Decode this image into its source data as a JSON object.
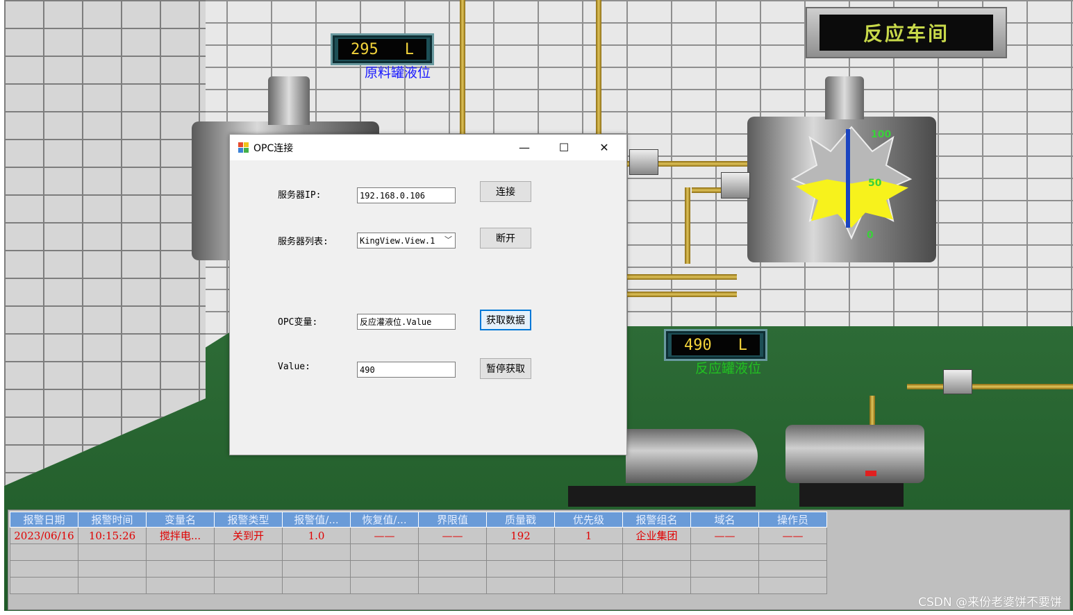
{
  "scene": {
    "raw_tank": {
      "value": "295",
      "unit": "L",
      "label": "原料罐液位"
    },
    "reactor_tank": {
      "value": "490",
      "unit": "L",
      "label": "反应罐液位",
      "scale": [
        "100",
        "50",
        "0"
      ],
      "level_fraction": 0.49
    },
    "workshop_title": "反应车间",
    "colors": {
      "display_text": "#f2d33b",
      "raw_label": "#1a1aff",
      "reactor_label": "#22c022",
      "alarm_text": "#e00000"
    }
  },
  "dialog": {
    "title": "OPC连接",
    "server_ip_label": "服务器IP:",
    "server_ip_value": "192.168.0.106",
    "server_list_label": "服务器列表:",
    "server_list_selected": "KingView.View.1",
    "opc_var_label": "OPC变量:",
    "opc_var_value": "反应灌液位.Value",
    "value_label": "Value:",
    "value_value": "490",
    "connect_btn": "连接",
    "disconnect_btn": "断开",
    "fetch_btn": "获取数据",
    "pause_btn": "暂停获取",
    "minimize_glyph": "—",
    "maximize_glyph": "☐",
    "close_glyph": "✕"
  },
  "alarm_table": {
    "headers": [
      "报警日期",
      "报警时间",
      "变量名",
      "报警类型",
      "报警值/...",
      "恢复值/...",
      "界限值",
      "质量戳",
      "优先级",
      "报警组名",
      "域名",
      "操作员"
    ],
    "rows": [
      [
        "2023/06/16",
        "10:15:26",
        "搅拌电...",
        "关到开",
        "1.0",
        "——",
        "——",
        "192",
        "1",
        "企业集团",
        "——",
        "——"
      ]
    ]
  },
  "watermark": "CSDN @来份老婆饼不要饼"
}
